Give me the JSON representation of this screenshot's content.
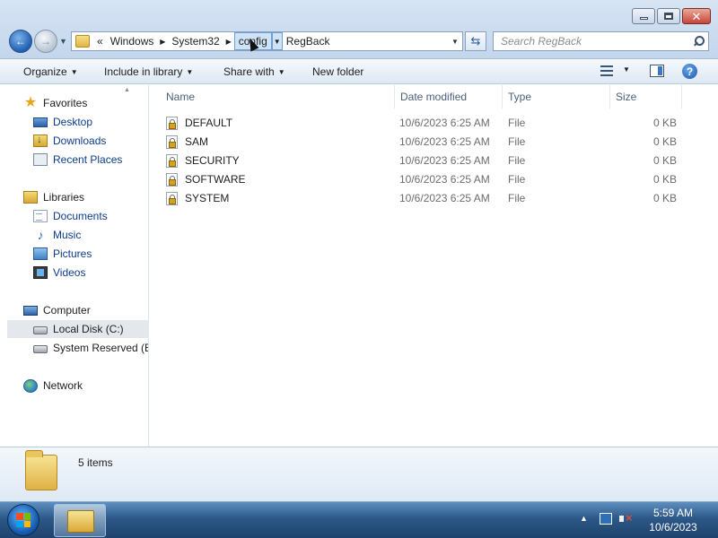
{
  "window": {
    "caption_buttons": [
      "minimize",
      "maximize",
      "close"
    ]
  },
  "address": {
    "overflow_glyph": "«",
    "crumbs": [
      "Windows",
      "System32",
      "config",
      "RegBack"
    ],
    "selected_crumb": "config"
  },
  "search": {
    "placeholder": "Search RegBack"
  },
  "toolbar": {
    "organize": "Organize",
    "include_in_library": "Include in library",
    "share_with": "Share with",
    "new_folder": "New folder"
  },
  "nav": {
    "favorites": "Favorites",
    "desktop": "Desktop",
    "downloads": "Downloads",
    "recent_places": "Recent Places",
    "libraries": "Libraries",
    "documents": "Documents",
    "music": "Music",
    "pictures": "Pictures",
    "videos": "Videos",
    "computer": "Computer",
    "local_disk": "Local Disk (C:)",
    "system_reserved": "System Reserved (E:)",
    "network": "Network",
    "selected": "Local Disk (C:)"
  },
  "columns": {
    "name": "Name",
    "date_modified": "Date modified",
    "type": "Type",
    "size": "Size"
  },
  "files": [
    {
      "name": "DEFAULT",
      "date": "10/6/2023 6:25 AM",
      "type": "File",
      "size": "0 KB"
    },
    {
      "name": "SAM",
      "date": "10/6/2023 6:25 AM",
      "type": "File",
      "size": "0 KB"
    },
    {
      "name": "SECURITY",
      "date": "10/6/2023 6:25 AM",
      "type": "File",
      "size": "0 KB"
    },
    {
      "name": "SOFTWARE",
      "date": "10/6/2023 6:25 AM",
      "type": "File",
      "size": "0 KB"
    },
    {
      "name": "SYSTEM",
      "date": "10/6/2023 6:25 AM",
      "type": "File",
      "size": "0 KB"
    }
  ],
  "details": {
    "item_count": "5 items"
  },
  "taskbar": {
    "time": "5:59 AM",
    "date": "10/6/2023"
  },
  "colors": {
    "link_text": "#0b3c8c",
    "selection": "#cfe3f7",
    "taskbar": "#2c5887"
  }
}
